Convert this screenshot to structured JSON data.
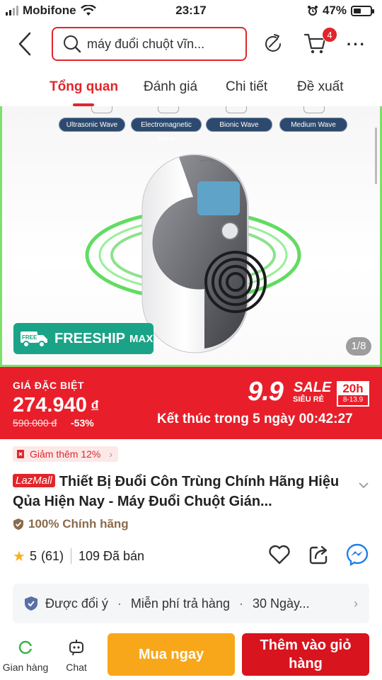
{
  "status_bar": {
    "carrier": "Mobifone",
    "time": "23:17",
    "battery_percent": "47%",
    "battery_level": 0.47,
    "icons": [
      "signal-icon",
      "wifi-icon",
      "alarm-icon",
      "battery-icon"
    ]
  },
  "header": {
    "search_text": "máy đuổi chuột vĩn...",
    "cart_count": "4",
    "icons": [
      "back-icon",
      "search-icon",
      "share-icon",
      "cart-icon",
      "more-icon"
    ]
  },
  "tabs": [
    {
      "label": "Tổng quan",
      "active": true
    },
    {
      "label": "Đánh giá",
      "active": false
    },
    {
      "label": "Chi tiết",
      "active": false
    },
    {
      "label": "Đề xuất",
      "active": false
    }
  ],
  "product_image": {
    "wave_chips": [
      "Ultrasonic Wave",
      "Electromagnetic Wave",
      "Bionic Wave",
      "Medium Wave"
    ],
    "freeship_badge": "FREESHIP",
    "freeship_max": "MAX",
    "freeship_tag": "FREE",
    "page_indicator": "1/8"
  },
  "price": {
    "label": "GIÁ ĐẶC BIỆT",
    "current": "274.940",
    "currency": "đ",
    "old": "590.000 đ",
    "discount": "-53%",
    "sale_logo": "9.9",
    "sale_word": "SALE",
    "sale_sub": "SIÊU RẺ",
    "sale_hours": "20h",
    "sale_dates": "8-13.9",
    "countdown": "Kết thúc trong 5 ngày 00:42:27"
  },
  "voucher": {
    "label": "Giảm thêm 12%"
  },
  "product": {
    "badge": "LazMall",
    "title": "Thiết Bị Đuổi Côn Trùng Chính Hãng Hiệu Qủa Hiện Nay - Máy Đuổi Chuột Gián...",
    "authentic": "100% Chính hãng",
    "rating": "5",
    "rating_count": "(61)",
    "sold": "109 Đã bán"
  },
  "policy": {
    "items": [
      "Được đổi ý",
      "Miễn phí trả hàng",
      "30 Ngày..."
    ],
    "separator": "·"
  },
  "bottom_bar": {
    "store_label": "Gian hàng",
    "chat_label": "Chat",
    "buy_now": "Mua ngay",
    "add_to_cart": "Thêm vào giỏ hàng"
  },
  "colors": {
    "brand_red": "#e1262b",
    "banner_red": "#e81f2a",
    "buy_orange": "#f8a71b",
    "freeship_green": "#1aa387",
    "star_yellow": "#f5b21d"
  }
}
